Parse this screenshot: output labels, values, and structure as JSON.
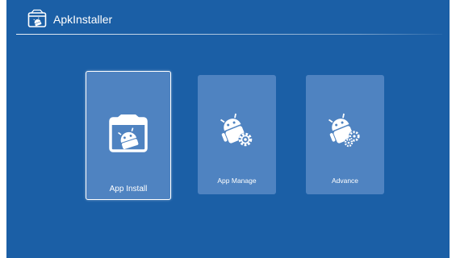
{
  "header": {
    "title": "ApkInstaller",
    "icon": "apk-installer-app-icon"
  },
  "tiles": [
    {
      "label": "App Install",
      "icon": "android-box-install-icon",
      "focused": true
    },
    {
      "label": "App Manage",
      "icon": "android-gear-icon",
      "focused": false
    },
    {
      "label": "Advance",
      "icon": "android-gears-icon",
      "focused": false
    }
  ],
  "colors": {
    "background": "#1b5fa6",
    "tile": "#4f83c1",
    "text": "#ffffff"
  }
}
